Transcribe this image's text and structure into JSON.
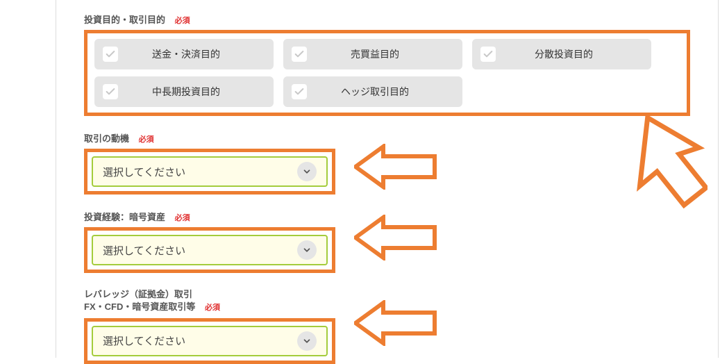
{
  "colors": {
    "accent": "#ed7d31",
    "select_border": "#a4cc3c",
    "select_bg": "#fffde8",
    "required": "#e03030"
  },
  "labels": {
    "required": "必須",
    "purpose_section": "投資目的・取引目的",
    "motivation_section": "取引の動機",
    "experience_crypto_section": "投資経験：暗号資産",
    "leverage_section_line1": "レバレッジ（証拠金）取引",
    "leverage_section_line2": "FX・CFD・暗号資産取引等"
  },
  "purpose_options": [
    {
      "id": "remittance",
      "label": "送金・決済目的"
    },
    {
      "id": "cap-gain",
      "label": "売買益目的"
    },
    {
      "id": "diversify",
      "label": "分散投資目的"
    },
    {
      "id": "long-term",
      "label": "中長期投資目的"
    },
    {
      "id": "hedge",
      "label": "ヘッジ取引目的"
    }
  ],
  "selects": {
    "motivation": {
      "value": "選択してください"
    },
    "experience_crypto": {
      "value": "選択してください"
    },
    "leverage": {
      "value": "選択してください"
    }
  }
}
